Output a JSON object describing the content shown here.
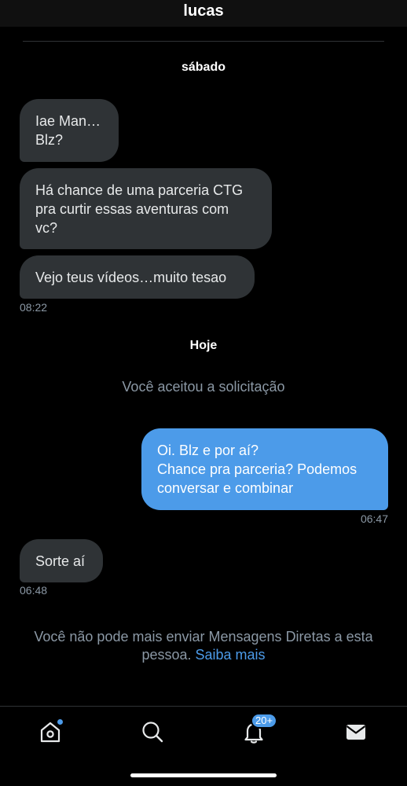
{
  "header": {
    "title": "lucas"
  },
  "days": {
    "first": "sábado",
    "second": "Hoje"
  },
  "messages": {
    "m1": "Iae Man…\nBlz?",
    "m2": "Há chance de uma parceria CTG\npra curtir essas aventuras com\nvc?",
    "m3": "Vejo teus vídeos…muito tesao",
    "m3_time": "08:22",
    "m4": "Oi. Blz e por aí?\nChance pra parceria? Podemos\nconversar e combinar",
    "m4_time": "06:47",
    "m5": "Sorte aí",
    "m5_time": "06:48"
  },
  "system": {
    "accepted": "Você aceitou a solicitação",
    "blocked_text": "Você não pode mais enviar Mensagens Diretas a esta pessoa.",
    "learn_more": "Saiba mais"
  },
  "nav": {
    "home_icon": "home-icon",
    "search_icon": "search-icon",
    "notifications_icon": "bell-icon",
    "notifications_badge": "20+",
    "messages_icon": "envelope-icon"
  },
  "colors": {
    "background": "#000000",
    "incoming_bubble": "#2f3336",
    "outgoing_bubble": "#4c9be9",
    "muted_text": "#8b98a5",
    "accent": "#4c9be9"
  }
}
